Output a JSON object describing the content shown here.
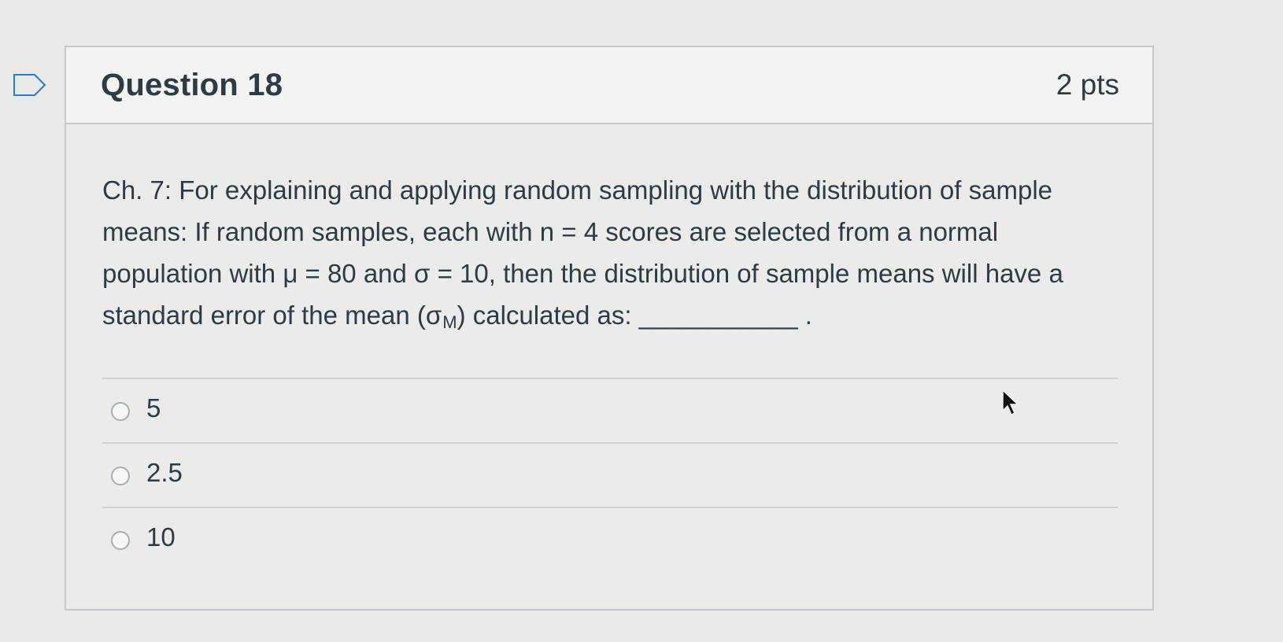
{
  "question": {
    "title": "Question 18",
    "points": "2 pts",
    "text_intro": "Ch. 7: For explaining and applying random sampling with the distribution of sample means: If random samples, each with n = 4 scores are selected from a normal population with μ = 80 and σ = 10, then the distribution of sample means will have a standard error of the mean (σ",
    "text_subscript": "M",
    "text_outro": ") calculated as: ___________ ."
  },
  "answers": [
    {
      "label": "5"
    },
    {
      "label": "2.5"
    },
    {
      "label": "10"
    }
  ],
  "icons": {
    "flag": "flag-icon",
    "pointer": "mouse-pointer-icon"
  }
}
